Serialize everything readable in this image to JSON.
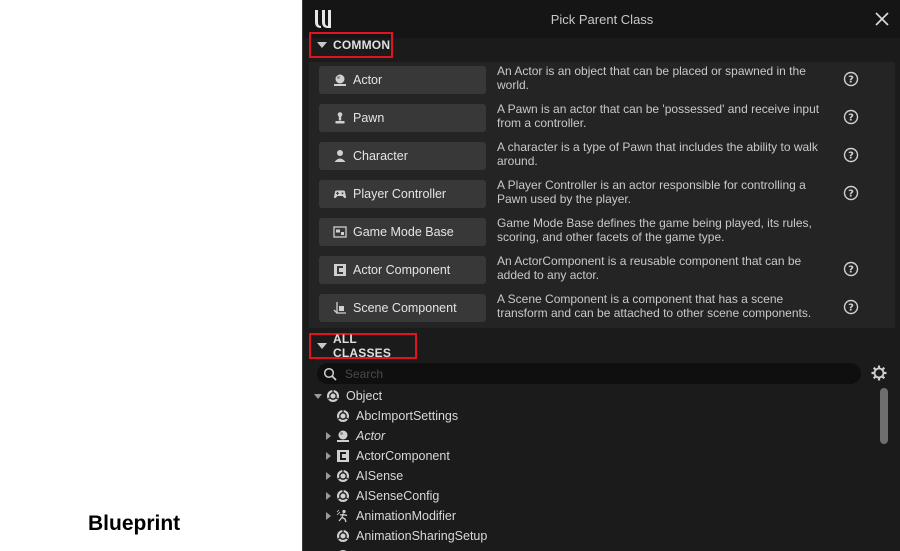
{
  "caption": "Blueprint",
  "dialog": {
    "title": "Pick Parent Class",
    "sections": {
      "common": "COMMON",
      "all_classes": "ALL CLASSES"
    },
    "common_classes": [
      {
        "label": "Actor",
        "icon": "actor-icon",
        "description": "An Actor is an object that can be placed or spawned in the world.",
        "has_help": true
      },
      {
        "label": "Pawn",
        "icon": "pawn-icon",
        "description": "A Pawn is an actor that can be 'possessed' and receive input from a controller.",
        "has_help": true
      },
      {
        "label": "Character",
        "icon": "character-icon",
        "description": "A character is a type of Pawn that includes the ability to walk around.",
        "has_help": true
      },
      {
        "label": "Player Controller",
        "icon": "gamepad-icon",
        "description": "A Player Controller is an actor responsible for controlling a Pawn used by the player.",
        "has_help": true
      },
      {
        "label": "Game Mode Base",
        "icon": "game-mode-icon",
        "description": "Game Mode Base defines the game being played, its rules, scoring, and other facets of the game type.",
        "has_help": false
      },
      {
        "label": "Actor Component",
        "icon": "actor-component-icon",
        "description": "An ActorComponent is a reusable component that can be added to any actor.",
        "has_help": true
      },
      {
        "label": "Scene Component",
        "icon": "scene-component-icon",
        "description": "A Scene Component is a component that has a scene transform and can be attached to other scene components.",
        "has_help": true
      }
    ],
    "search": {
      "placeholder": "Search",
      "value": ""
    },
    "tree": [
      {
        "label": "Object",
        "expander": "expanded",
        "icon": "object-icon",
        "level": 0,
        "italic": false
      },
      {
        "label": "AbcImportSettings",
        "expander": "none",
        "icon": "object-icon",
        "level": 1,
        "italic": false
      },
      {
        "label": "Actor",
        "expander": "collapsed",
        "icon": "actor-icon",
        "level": 1,
        "italic": true
      },
      {
        "label": "ActorComponent",
        "expander": "collapsed",
        "icon": "actor-component-icon",
        "level": 1,
        "italic": false
      },
      {
        "label": "AISense",
        "expander": "collapsed",
        "icon": "object-icon",
        "level": 1,
        "italic": false
      },
      {
        "label": "AISenseConfig",
        "expander": "collapsed",
        "icon": "object-icon",
        "level": 1,
        "italic": false
      },
      {
        "label": "AnimationModifier",
        "expander": "collapsed",
        "icon": "animation-modifier-icon",
        "level": 1,
        "italic": false
      },
      {
        "label": "AnimationSharingSetup",
        "expander": "none",
        "icon": "object-icon",
        "level": 1,
        "italic": false
      },
      {
        "label": "",
        "expander": "none",
        "icon": "object-icon",
        "level": 1,
        "italic": false
      }
    ]
  }
}
